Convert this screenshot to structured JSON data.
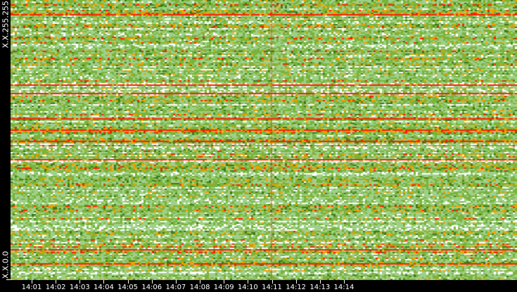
{
  "chart_data": {
    "type": "heatmap",
    "title": "",
    "xlabel": "",
    "ylabel": "",
    "x_tick_labels": [
      "14:01",
      "14:02",
      "14:03",
      "14:04",
      "14:05",
      "14:06",
      "14:07",
      "14:08",
      "14:09",
      "14:10",
      "14:11",
      "14:12",
      "14:13",
      "14:14"
    ],
    "y_labels": {
      "top": "X.X.255.255",
      "bottom": "X.X.0.0"
    },
    "x_range_minutes": [
      14.0,
      14.99
    ],
    "colorscale": [
      "#ffffff",
      "#9fd08a",
      "#7ab33a",
      "#3f7a1a",
      "#f0a000",
      "#ff2000"
    ],
    "highlight_rows_fraction": [
      0.05,
      0.3,
      0.33,
      0.42,
      0.46,
      0.5,
      0.57,
      0.89,
      0.94
    ],
    "highlight_column_time": "14:11"
  }
}
